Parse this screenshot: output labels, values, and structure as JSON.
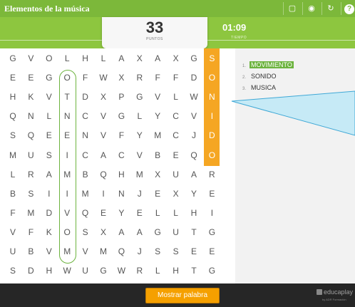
{
  "header": {
    "title": "Elementos de la música",
    "tools": [
      "fullscreen-icon",
      "eye-icon",
      "restart-icon",
      "help-icon"
    ]
  },
  "score": {
    "value": "33",
    "label": "PUNTOS"
  },
  "timer": {
    "value": "01:09",
    "label": "TIEMPO"
  },
  "grid": {
    "rows": [
      [
        "G",
        "V",
        "O",
        "L",
        "H",
        "L",
        "A",
        "X",
        "A",
        "X",
        "G",
        "S"
      ],
      [
        "E",
        "E",
        "G",
        "O",
        "F",
        "W",
        "X",
        "R",
        "F",
        "F",
        "D",
        "O"
      ],
      [
        "H",
        "K",
        "V",
        "T",
        "D",
        "X",
        "P",
        "G",
        "V",
        "L",
        "W",
        "N"
      ],
      [
        "Q",
        "N",
        "L",
        "N",
        "C",
        "V",
        "G",
        "L",
        "Y",
        "C",
        "V",
        "I"
      ],
      [
        "S",
        "Q",
        "E",
        "E",
        "N",
        "V",
        "F",
        "Y",
        "M",
        "C",
        "J",
        "D"
      ],
      [
        "M",
        "U",
        "S",
        "I",
        "C",
        "A",
        "C",
        "V",
        "B",
        "E",
        "Q",
        "O"
      ],
      [
        "L",
        "R",
        "A",
        "M",
        "B",
        "Q",
        "H",
        "M",
        "X",
        "U",
        "A",
        "R"
      ],
      [
        "B",
        "S",
        "I",
        "I",
        "M",
        "I",
        "N",
        "J",
        "E",
        "X",
        "Y",
        "E"
      ],
      [
        "F",
        "M",
        "D",
        "V",
        "Q",
        "E",
        "Y",
        "E",
        "L",
        "L",
        "H",
        "I"
      ],
      [
        "V",
        "F",
        "K",
        "O",
        "S",
        "X",
        "A",
        "A",
        "G",
        "U",
        "T",
        "G"
      ],
      [
        "U",
        "B",
        "V",
        "M",
        "V",
        "M",
        "Q",
        "J",
        "S",
        "S",
        "E",
        "E"
      ],
      [
        "S",
        "D",
        "H",
        "W",
        "U",
        "G",
        "W",
        "R",
        "L",
        "H",
        "T",
        "G"
      ]
    ],
    "highlighted_column": {
      "col": 11,
      "row_start": 0,
      "row_end": 5
    },
    "found_word": {
      "col": 3,
      "row_start": 1,
      "row_end": 10
    },
    "colors": {
      "highlight": "#f5a623",
      "found": "#6cb33e",
      "letters": "#555555"
    }
  },
  "words": [
    {
      "num": "1.",
      "text": "MOVIMIENTO",
      "found": true
    },
    {
      "num": "2.",
      "text": "SONIDO",
      "found": false
    },
    {
      "num": "3.",
      "text": "MUSICA",
      "found": false
    }
  ],
  "footer": {
    "show_word_label": "Mostrar palabra",
    "brand": "educaplay",
    "brand_sub": "by ADR Formación"
  },
  "colors": {
    "topbar": "#7cb83a",
    "band": "#8dc63f",
    "footer": "#262626",
    "button": "#f5a000"
  }
}
